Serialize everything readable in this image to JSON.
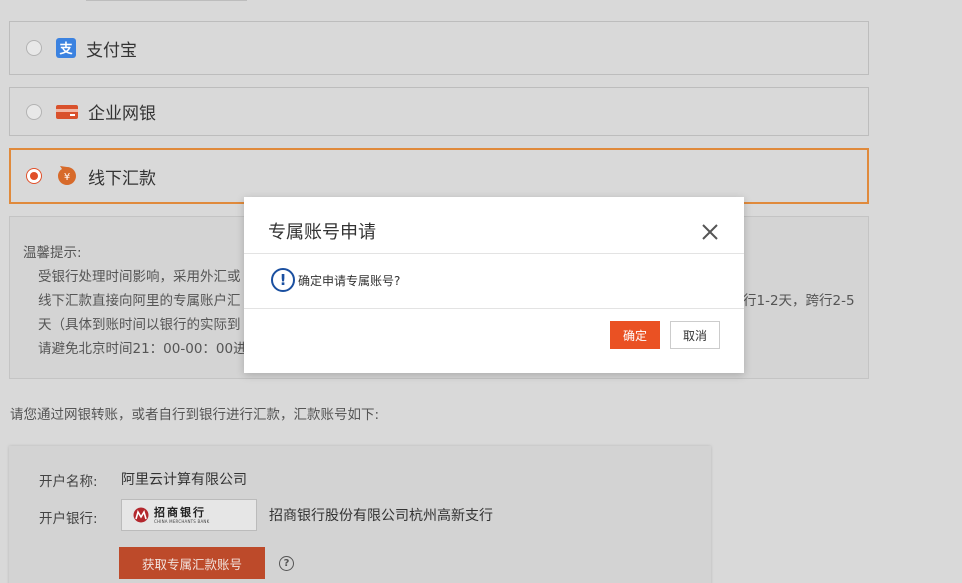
{
  "payment_options": [
    {
      "label": "支付宝",
      "icon": "alipay-icon",
      "selected": false
    },
    {
      "label": "企业网银",
      "icon": "bank-card-icon",
      "selected": false
    },
    {
      "label": "线下汇款",
      "icon": "offline-remit-icon",
      "selected": true
    }
  ],
  "tips": {
    "title": "温馨提示:",
    "lines": [
      "受银行处理时间影响，采用外汇或",
      "线下汇款直接向阿里的专属账户汇",
      "天（具体到账时间以银行的实际到",
      "请避免北京时间21：00-00：00进"
    ],
    "line2_tail": "行1-2天，跨行2-5"
  },
  "instruction": "请您通过网银转账，或者自行到银行进行汇款，汇款账号如下:",
  "account": {
    "name_label": "开户名称:",
    "name_value": "阿里云计算有限公司",
    "bank_label": "开户银行:",
    "bank_logo_cn": "招商银行",
    "bank_logo_en": "CHINA MERCHANTS BANK",
    "bank_value": "招商银行股份有限公司杭州高新支行",
    "get_button": "获取专属汇款账号",
    "help": "?"
  },
  "modal": {
    "title": "专属账号申请",
    "message": "确定申请专属账号?",
    "warn_glyph": "!",
    "ok": "确定",
    "cancel": "取消"
  },
  "colors": {
    "accent": "#ea5123",
    "selected_border": "#e08a3c",
    "alipay": "#1677ff",
    "info": "#1a4fa0"
  }
}
